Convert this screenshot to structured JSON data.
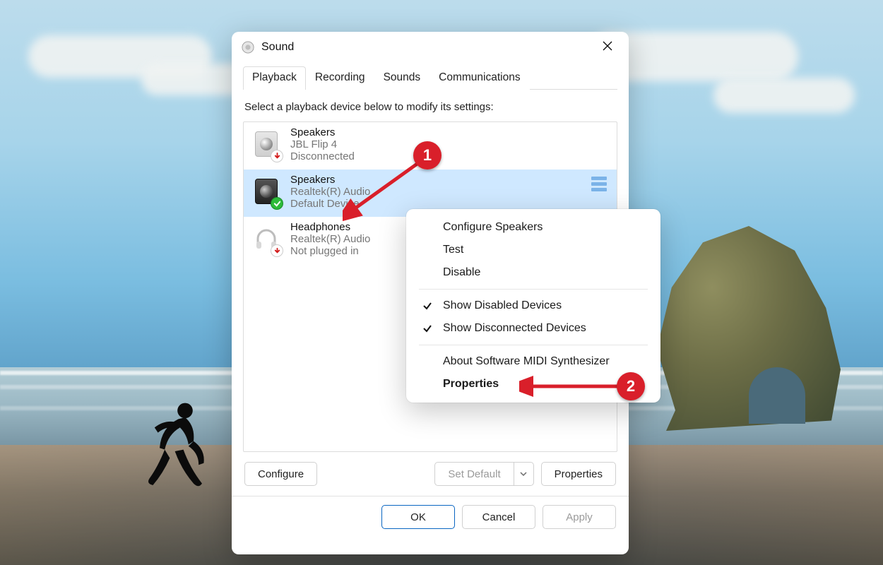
{
  "window": {
    "title": "Sound",
    "tabs": [
      "Playback",
      "Recording",
      "Sounds",
      "Communications"
    ],
    "active_tab_index": 0,
    "instruction": "Select a playback device below to modify its settings:"
  },
  "devices": [
    {
      "name": "Speakers",
      "line2": "JBL Flip 4",
      "line3": "Disconnected",
      "status": "disconnected",
      "selected": false,
      "icon": "speaker-light"
    },
    {
      "name": "Speakers",
      "line2": "Realtek(R) Audio",
      "line3": "Default Device",
      "status": "default",
      "selected": true,
      "icon": "speaker-dark"
    },
    {
      "name": "Headphones",
      "line2": "Realtek(R) Audio",
      "line3": "Not plugged in",
      "status": "unplugged",
      "selected": false,
      "icon": "headphones"
    }
  ],
  "buttons": {
    "configure": "Configure",
    "set_default": "Set Default",
    "properties": "Properties",
    "ok": "OK",
    "cancel": "Cancel",
    "apply": "Apply"
  },
  "context_menu": {
    "items": [
      {
        "label": "Configure Speakers",
        "checked": false
      },
      {
        "label": "Test",
        "checked": false
      },
      {
        "label": "Disable",
        "checked": false
      }
    ],
    "items2": [
      {
        "label": "Show Disabled Devices",
        "checked": true
      },
      {
        "label": "Show Disconnected Devices",
        "checked": true
      }
    ],
    "items3": [
      {
        "label": "About Software MIDI Synthesizer",
        "checked": false
      },
      {
        "label": "Properties",
        "checked": false,
        "bold": true
      }
    ]
  },
  "annotations": {
    "marker1": "1",
    "marker2": "2"
  }
}
